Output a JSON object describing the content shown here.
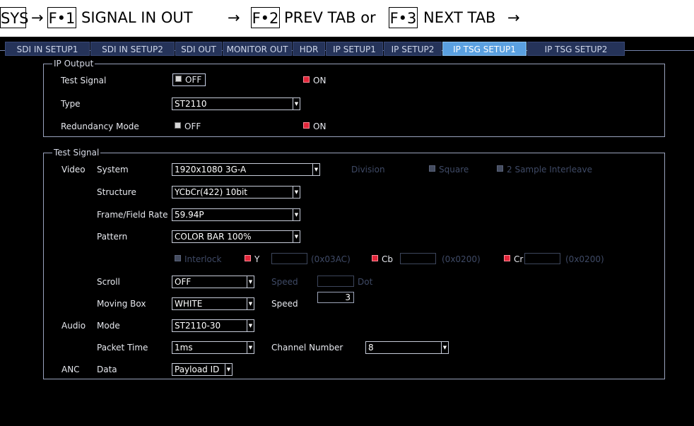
{
  "nav": {
    "sys": "SYS",
    "arrow": "→",
    "f1_key": "F•1",
    "f1_label": "SIGNAL IN OUT",
    "f2_key": "F•2",
    "f2_label": "PREV TAB or",
    "f3_key": "F•3",
    "f3_label": "NEXT TAB"
  },
  "tabs": [
    {
      "label": "SDI IN SETUP1",
      "active": false
    },
    {
      "label": "SDI IN SETUP2",
      "active": false
    },
    {
      "label": "SDI OUT",
      "active": false
    },
    {
      "label": "MONITOR OUT",
      "active": false
    },
    {
      "label": "HDR",
      "active": false
    },
    {
      "label": "IP SETUP1",
      "active": false
    },
    {
      "label": "IP SETUP2",
      "active": false
    },
    {
      "label": "IP TSG SETUP1",
      "active": true
    },
    {
      "label": "IP TSG SETUP2",
      "active": false
    }
  ],
  "ip_output": {
    "title": "IP Output",
    "test_signal_label": "Test Signal",
    "test_signal_off": "OFF",
    "test_signal_on": "ON",
    "test_signal_value": "ON",
    "type_label": "Type",
    "type_value": "ST2110",
    "redundancy_label": "Redundancy Mode",
    "redundancy_off": "OFF",
    "redundancy_on": "ON",
    "redundancy_value": "ON"
  },
  "test_signal": {
    "title": "Test Signal",
    "video_label": "Video",
    "system_label": "System",
    "system_value": "1920x1080 3G-A",
    "division_label": "Division",
    "square_label": "Square",
    "sample_interleave_label": "2 Sample Interleave",
    "structure_label": "Structure",
    "structure_value": "YCbCr(422) 10bit",
    "frame_rate_label": "Frame/Field Rate",
    "frame_rate_value": "59.94P",
    "pattern_label": "Pattern",
    "pattern_value": "COLOR BAR 100%",
    "interlock_label": "Interlock",
    "y_label": "Y",
    "y_value": "",
    "y_hex": "(0x03AC)",
    "cb_label": "Cb",
    "cb_value": "",
    "cb_hex": "(0x0200)",
    "cr_label": "Cr",
    "cr_value": "",
    "cr_hex": "(0x0200)",
    "scroll_label": "Scroll",
    "scroll_value": "OFF",
    "scroll_speed_label": "Speed",
    "scroll_speed_value": "",
    "dot_label": "Dot",
    "moving_box_label": "Moving Box",
    "moving_box_value": "WHITE",
    "box_speed_label": "Speed",
    "box_speed_value": "3",
    "audio_label": "Audio",
    "mode_label": "Mode",
    "mode_value": "ST2110-30",
    "packet_time_label": "Packet Time",
    "packet_time_value": "1ms",
    "channel_number_label": "Channel Number",
    "channel_number_value": "8",
    "anc_label": "ANC",
    "data_label": "Data",
    "data_value": "Payload ID"
  },
  "colors": {
    "background": "#000000",
    "tab": "#253359",
    "tab_active": "#5aa0e0",
    "check_on": "#e2263a",
    "check_off": "#d7d7d7",
    "disabled_text": "#3f4a66"
  },
  "icons": {
    "dropdown": "chevron-down-icon",
    "checkbox_on": "checkbox-checked-icon",
    "checkbox_off": "checkbox-unchecked-icon"
  }
}
